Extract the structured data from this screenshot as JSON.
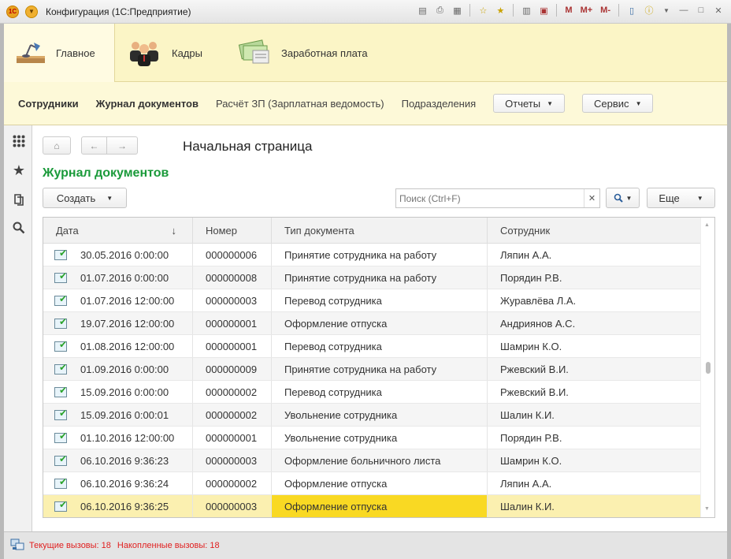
{
  "window": {
    "title": "Конфигурация (1С:Предприятие)",
    "logo_text": "1С",
    "toolbar_m": "M",
    "toolbar_mplus": "M+",
    "toolbar_mminus": "M-"
  },
  "sections": [
    {
      "label": "Главное",
      "icon": "desk-lamp-icon"
    },
    {
      "label": "Кадры",
      "icon": "people-icon"
    },
    {
      "label": "Заработная плата",
      "icon": "money-icon"
    }
  ],
  "subnav": {
    "items": [
      "Сотрудники",
      "Журнал документов",
      "Расчёт ЗП (Зарплатная ведомость)",
      "Подразделения"
    ],
    "reports_label": "Отчеты",
    "service_label": "Сервис"
  },
  "page": {
    "title": "Начальная страница",
    "form_title": "Журнал документов"
  },
  "form_toolbar": {
    "create_label": "Создать",
    "search_placeholder": "Поиск (Ctrl+F)",
    "more_label": "Еще"
  },
  "table": {
    "columns": [
      "Дата",
      "Номер",
      "Тип документа",
      "Сотрудник"
    ],
    "sort_indicator": "↓",
    "rows": [
      {
        "date": "30.05.2016 0:00:00",
        "number": "000000006",
        "type": "Принятие сотрудника на работу",
        "employee": "Ляпин А.А."
      },
      {
        "date": "01.07.2016 0:00:00",
        "number": "000000008",
        "type": "Принятие сотрудника на работу",
        "employee": "Порядин Р.В."
      },
      {
        "date": "01.07.2016 12:00:00",
        "number": "000000003",
        "type": "Перевод сотрудника",
        "employee": "Журавлёва Л.А."
      },
      {
        "date": "19.07.2016 12:00:00",
        "number": "000000001",
        "type": "Оформление отпуска",
        "employee": "Андриянов А.С."
      },
      {
        "date": "01.08.2016 12:00:00",
        "number": "000000001",
        "type": "Перевод сотрудника",
        "employee": "Шамрин К.О."
      },
      {
        "date": "01.09.2016 0:00:00",
        "number": "000000009",
        "type": "Принятие сотрудника на работу",
        "employee": "Ржевский В.И."
      },
      {
        "date": "15.09.2016 0:00:00",
        "number": "000000002",
        "type": "Перевод сотрудника",
        "employee": "Ржевский В.И."
      },
      {
        "date": "15.09.2016 0:00:01",
        "number": "000000002",
        "type": "Увольнение сотрудника",
        "employee": "Шалин К.И."
      },
      {
        "date": "01.10.2016 12:00:00",
        "number": "000000001",
        "type": "Увольнение сотрудника",
        "employee": "Порядин Р.В."
      },
      {
        "date": "06.10.2016 9:36:23",
        "number": "000000003",
        "type": "Оформление больничного листа",
        "employee": "Шамрин К.О."
      },
      {
        "date": "06.10.2016 9:36:24",
        "number": "000000002",
        "type": "Оформление отпуска",
        "employee": "Ляпин А.А."
      },
      {
        "date": "06.10.2016 9:36:25",
        "number": "000000003",
        "type": "Оформление отпуска",
        "employee": "Шалин К.И."
      }
    ]
  },
  "status": {
    "current_calls": "Текущие вызовы: 18",
    "accumulated_calls": "Накопленные вызовы: 18"
  },
  "colors": {
    "accent_green": "#1a9a3a",
    "section_bg": "#fbf5c6",
    "selected_cell": "#f9d923",
    "status_red": "#e02020"
  }
}
